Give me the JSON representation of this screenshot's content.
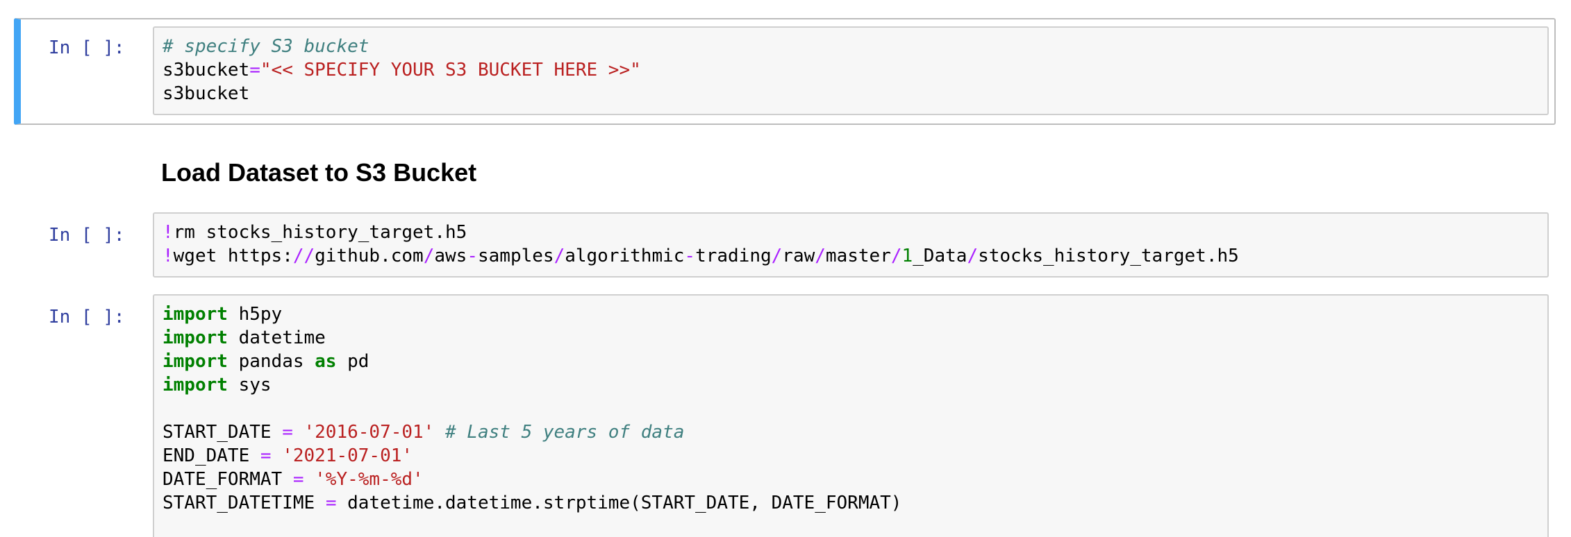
{
  "cells": {
    "c1": {
      "prompt": "In [ ]:",
      "comment": "# specify S3 bucket",
      "assign_var": "s3bucket",
      "assign_op": "=",
      "assign_str": "\"<< SPECIFY YOUR S3 BUCKET HERE >>\"",
      "line3": "s3bucket"
    },
    "heading": "Load Dataset to S3 Bucket",
    "c2": {
      "prompt": "In [ ]:",
      "l1_bang": "!",
      "l1_rest": "rm stocks_history_target.h5",
      "l2_bang": "!",
      "l2_p1": "wget https:",
      "l2_s1": "//",
      "l2_p2": "github.com",
      "l2_s2": "/",
      "l2_p3": "aws",
      "l2_s3": "-",
      "l2_p4": "samples",
      "l2_s4": "/",
      "l2_p5": "algorithmic",
      "l2_s5": "-",
      "l2_p6": "trading",
      "l2_s6": "/",
      "l2_p7": "raw",
      "l2_s7": "/",
      "l2_p8": "master",
      "l2_s8": "/",
      "l2_num": "1",
      "l2_p9": "_Data",
      "l2_s9": "/",
      "l2_p10": "stocks_history_target.h5"
    },
    "c3": {
      "prompt": "In [ ]:",
      "kw_import": "import",
      "kw_as": "as",
      "mod_h5py": " h5py",
      "mod_datetime": " datetime",
      "mod_pandas": " pandas ",
      "alias_pd": " pd",
      "mod_sys": " sys",
      "start_var": "START_DATE ",
      "eq": "=",
      "start_val": " '2016-07-01'",
      "start_comment": " # Last 5 years of data",
      "end_var": "END_DATE ",
      "end_val": " '2021-07-01'",
      "fmt_var": "DATE_FORMAT ",
      "fmt_val": " '%Y-%m-%d'",
      "sdt_var": "START_DATETIME ",
      "sdt_rest": " datetime.datetime.strptime(START_DATE, DATE_FORMAT)"
    }
  },
  "colors": {
    "prompt": "#303f9f",
    "keyword": "#008000",
    "operator": "#aa22ff",
    "string": "#ba2121",
    "comment": "#408080",
    "selected_border": "#42a5f5"
  }
}
